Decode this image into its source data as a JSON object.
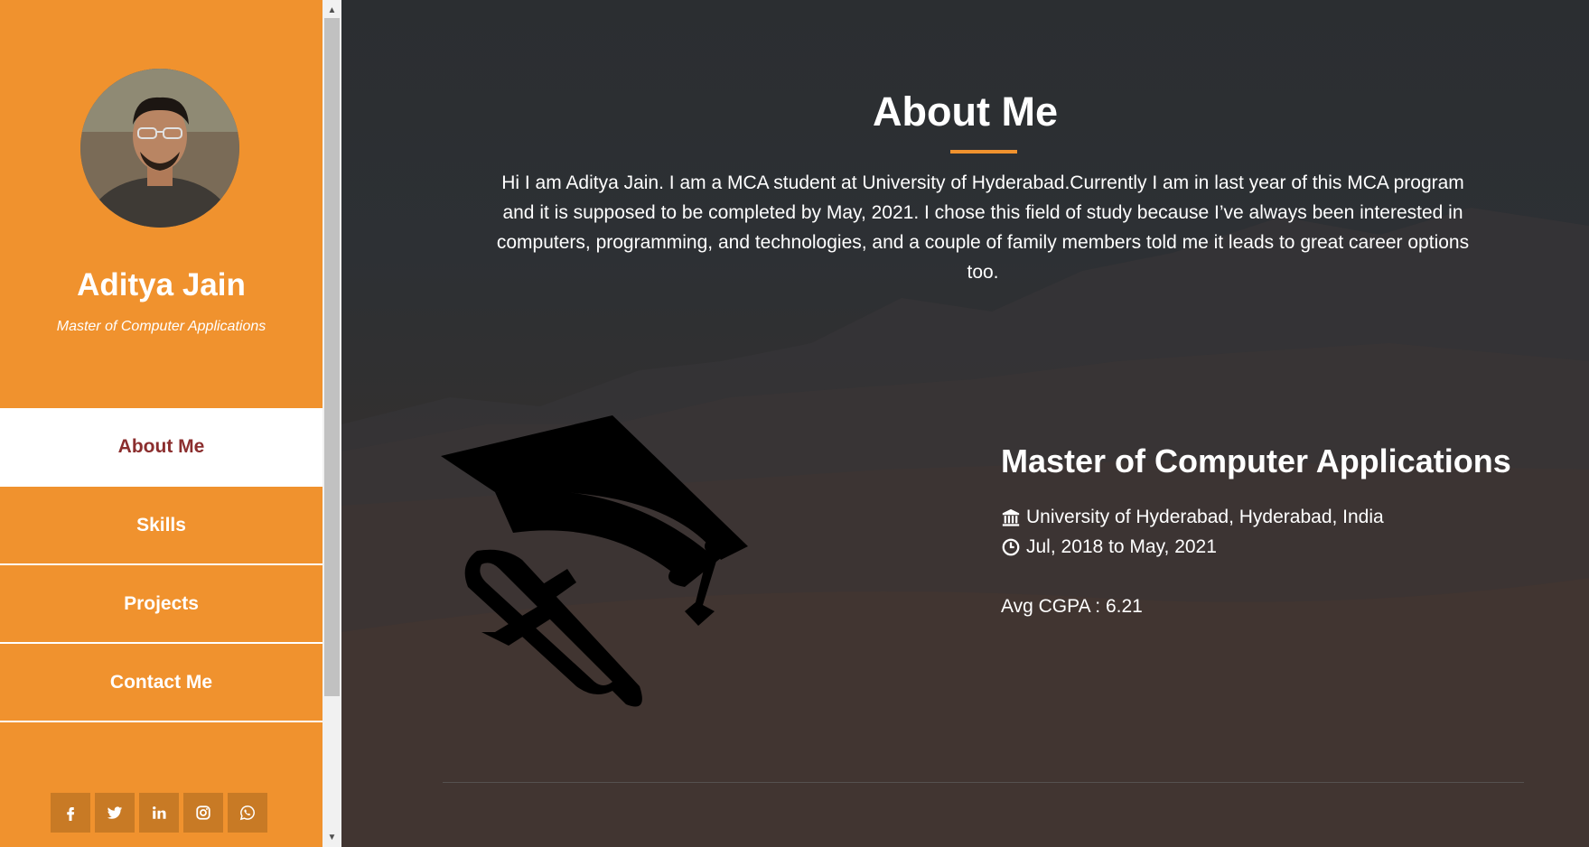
{
  "profile": {
    "name": "Aditya Jain",
    "role": "Master of Computer Applications"
  },
  "nav": {
    "items": [
      {
        "label": "About Me",
        "active": true
      },
      {
        "label": "Skills",
        "active": false
      },
      {
        "label": "Projects",
        "active": false
      },
      {
        "label": "Contact Me",
        "active": false
      }
    ]
  },
  "social": {
    "icons": [
      "facebook-icon",
      "twitter-icon",
      "linkedin-icon",
      "instagram-icon",
      "whatsapp-icon"
    ]
  },
  "about": {
    "title": "About Me",
    "text": "Hi I am Aditya Jain. I am a MCA student at University of Hyderabad.Currently I am in last year of this MCA program and it is supposed to be completed by May, 2021. I chose this field of study because I’ve always been interested in computers, programming, and technologies, and a couple of family members told me it leads to great career options too."
  },
  "education": {
    "degree": "Master of Computer Applications",
    "university": "University of Hyderabad, Hyderabad, India",
    "duration": "Jul, 2018 to May, 2021",
    "cgpa": "Avg CGPA : 6.21"
  },
  "colors": {
    "accent": "#f0922e",
    "active_nav_text": "#8b2e2e"
  }
}
